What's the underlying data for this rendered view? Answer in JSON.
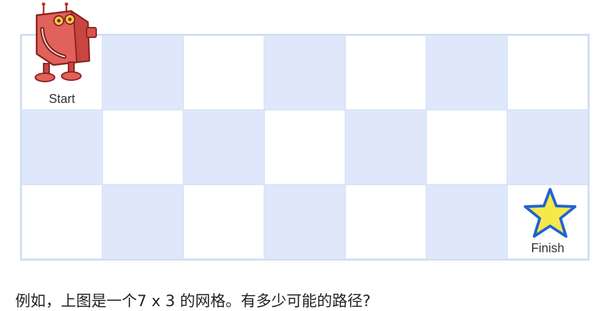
{
  "grid": {
    "columns": 7,
    "rows": 3,
    "start_label": "Start",
    "finish_label": "Finish",
    "colors": {
      "blue": "#dfe8fb",
      "white": "#ffffff",
      "border": "#cfdcf3"
    }
  },
  "icons": {
    "start": "robot-icon",
    "finish": "star-icon"
  },
  "caption": "例如，上图是一个7 x 3 的网格。有多少可能的路径?"
}
